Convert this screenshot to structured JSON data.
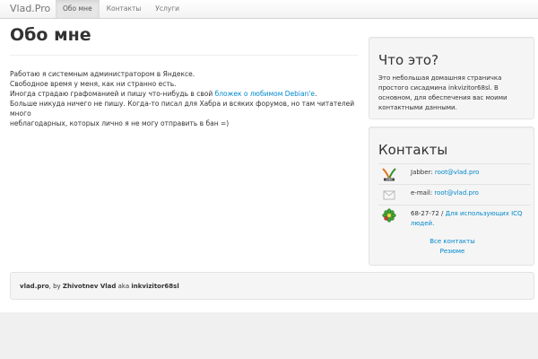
{
  "navbar": {
    "brand": "Vlad.Pro",
    "items": [
      {
        "label": "Обо мне",
        "active": true
      },
      {
        "label": "Контакты",
        "active": false
      },
      {
        "label": "Услуги",
        "active": false
      }
    ]
  },
  "main": {
    "title": "Обо мне",
    "line1": "Работаю я системным администратором в Яндексе.",
    "line2": "Свободное время у меня, как ни странно есть.",
    "line3_before": "Иногда страдаю графоманией и пишу что-нибудь в свой ",
    "line3_link": "бложек о любимом Debian'е",
    "line3_after": ".",
    "line4": "Больше никуда ничего не пишу. Когда-то писал для Хабра и всяких форумов, но там читателей много",
    "line5": "неблагодарных, которых лично я не могу отправить в бан =)"
  },
  "about_box": {
    "title": "Что это?",
    "description": "Это небольшая домашняя страничка простого сисадмина inkvizitor68sl. В основном, для обеспечения вас моими контактными данными."
  },
  "contacts_box": {
    "title": "Контакты",
    "jabber_label": "Jabber: ",
    "jabber_value": "root@vlad.pro",
    "email_label": "e-mail: ",
    "email_value": "root@vlad.pro",
    "icq_number": "68-27-72",
    "icq_sep": " / ",
    "icq_link": "Для использующих ICQ людей.",
    "all_contacts": "Все контакты",
    "resume": "Резюме",
    "icons": [
      "xmpp-icon",
      "envelope-icon",
      "icq-flower-icon"
    ]
  },
  "footer": {
    "site": "vlad.pro",
    "by": ", by ",
    "name": "Zhivotnev Vlad",
    "aka": " aka ",
    "nick": "inkvizitor68sl"
  },
  "colors": {
    "link": "#0088cc",
    "text": "#333333",
    "well_bg": "#f5f5f5",
    "page_bg": "#f0f0f0"
  }
}
